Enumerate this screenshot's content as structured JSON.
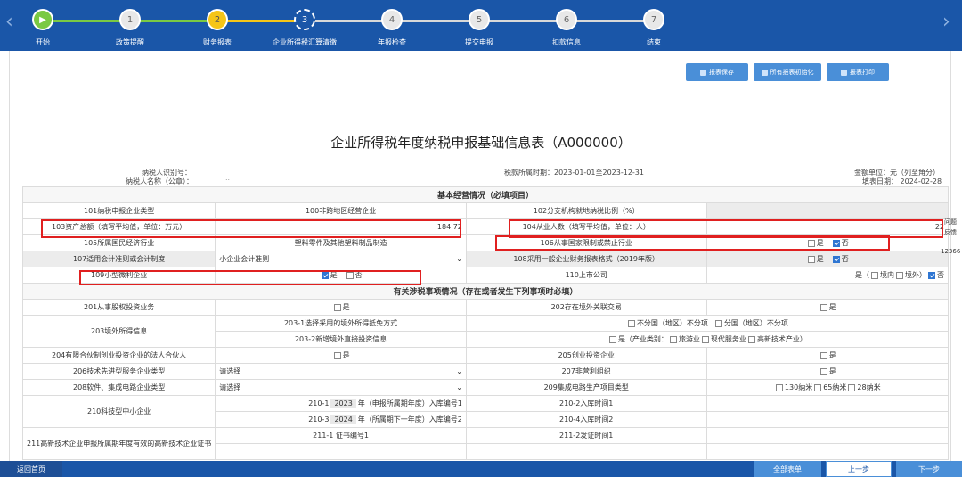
{
  "steps": [
    {
      "num": "",
      "label": "开始",
      "state": "done"
    },
    {
      "num": "1",
      "label": "政策提醒",
      "state": "todo"
    },
    {
      "num": "2",
      "label": "财务报表",
      "state": "warn"
    },
    {
      "num": "3",
      "label": "企业所得税汇算清缴",
      "state": "current"
    },
    {
      "num": "4",
      "label": "年报检查",
      "state": "todo"
    },
    {
      "num": "5",
      "label": "提交申报",
      "state": "todo"
    },
    {
      "num": "6",
      "label": "扣款信息",
      "state": "todo"
    },
    {
      "num": "7",
      "label": "结束",
      "state": "todo"
    }
  ],
  "nav": {
    "prev": "‹",
    "next": "›"
  },
  "toolbar": {
    "save": "报表保存",
    "init": "所有报表初始化",
    "print": "报表打印"
  },
  "form": {
    "title": "企业所得税年度纳税申报基础信息表（A000000）",
    "taxpayer_id_label": "纳税人识别号：",
    "taxpayer_name_label": "纳税人名称（公章）：",
    "taxpayer_name_value": "..",
    "period": "税款所属时期：2023-01-01至2023-12-31",
    "unit": "金额单位：元（列至角分）",
    "fill_date": "填表日期：  2024-02-28"
  },
  "edge_texts": {
    "a": "问题",
    "b": "反馈",
    "c": "12366"
  },
  "sections": {
    "basic": "基本经营情况（必填项目）",
    "tax": "有关涉税事项情况（存在或者发生下列事项时必填）"
  },
  "rows": {
    "r101": "101纳税申报企业类型",
    "r100": "100非跨地区经营企业",
    "r102": "102分支机构就地纳税比例（%）",
    "r103": "103资产总额（填写平均值，单位：万元）",
    "r103_value": "184.72",
    "r104": "104从业人数（填写平均值，单位：人）",
    "r104_value": "22",
    "r105": "105所属国民经济行业",
    "r105_value": "塑料零件及其他塑料制品制造",
    "r106": "106从事国家限制或禁止行业",
    "r107": "107适用会计准则或会计制度",
    "r107_value": "小企业会计准则",
    "r108": "108采用一般企业财务报表格式（2019年版）",
    "r109": "109小型微利企业",
    "r110": "110上市公司",
    "r110_opt_prefix": "是（",
    "r110_opt1": "境内",
    "r110_opt2": "境外）",
    "r201": "201从事股权投资业务",
    "r202": "202存在境外关联交易",
    "r203": "203境外所得信息",
    "r203_1": "203-1选择采用的境外所得抵免方式",
    "r203_1_opt1": "不分国（地区）不分项",
    "r203_1_opt2": "分国（地区）不分项",
    "r203_2": "203-2新增境外直接投资信息",
    "r203_2_opt": "是（产业类别：",
    "r203_2_c1": "旅游业",
    "r203_2_c2": "现代服务业",
    "r203_2_c3": "高新技术产业）",
    "r204": "204有限合伙制创业投资企业的法人合伙人",
    "r205": "205创业投资企业",
    "r206": "206技术先进型服务企业类型",
    "r207": "207非营利组织",
    "r208": "208软件、集成电路企业类型",
    "r209": "209集成电路生产项目类型",
    "r209_opt1": "130纳米",
    "r209_opt2": "65纳米",
    "r209_opt3": "28纳米",
    "r210": "210科技型中小企业",
    "r210_1_prefix": "210-1",
    "r210_1_year": "2023",
    "r210_1_suffix": "年（申报所属期年度）入库编号1",
    "r210_2": "210-2入库时间1",
    "r210_3_prefix": "210-3",
    "r210_3_year": "2024",
    "r210_3_suffix": "年（所属期下一年度）入库编号2",
    "r210_4": "210-4入库时间2",
    "r211": "211高新技术企业申报所属期年度有效的高新技术企业证书",
    "r211_1": "211-1 证书编号1",
    "r211_2": "211-2发证时间1"
  },
  "options": {
    "yes": "是",
    "no": "否",
    "select_placeholder": "请选择"
  },
  "bottom": {
    "home": "返回首页",
    "all": "全部表单",
    "prev": "上一步",
    "next": "下一步"
  }
}
